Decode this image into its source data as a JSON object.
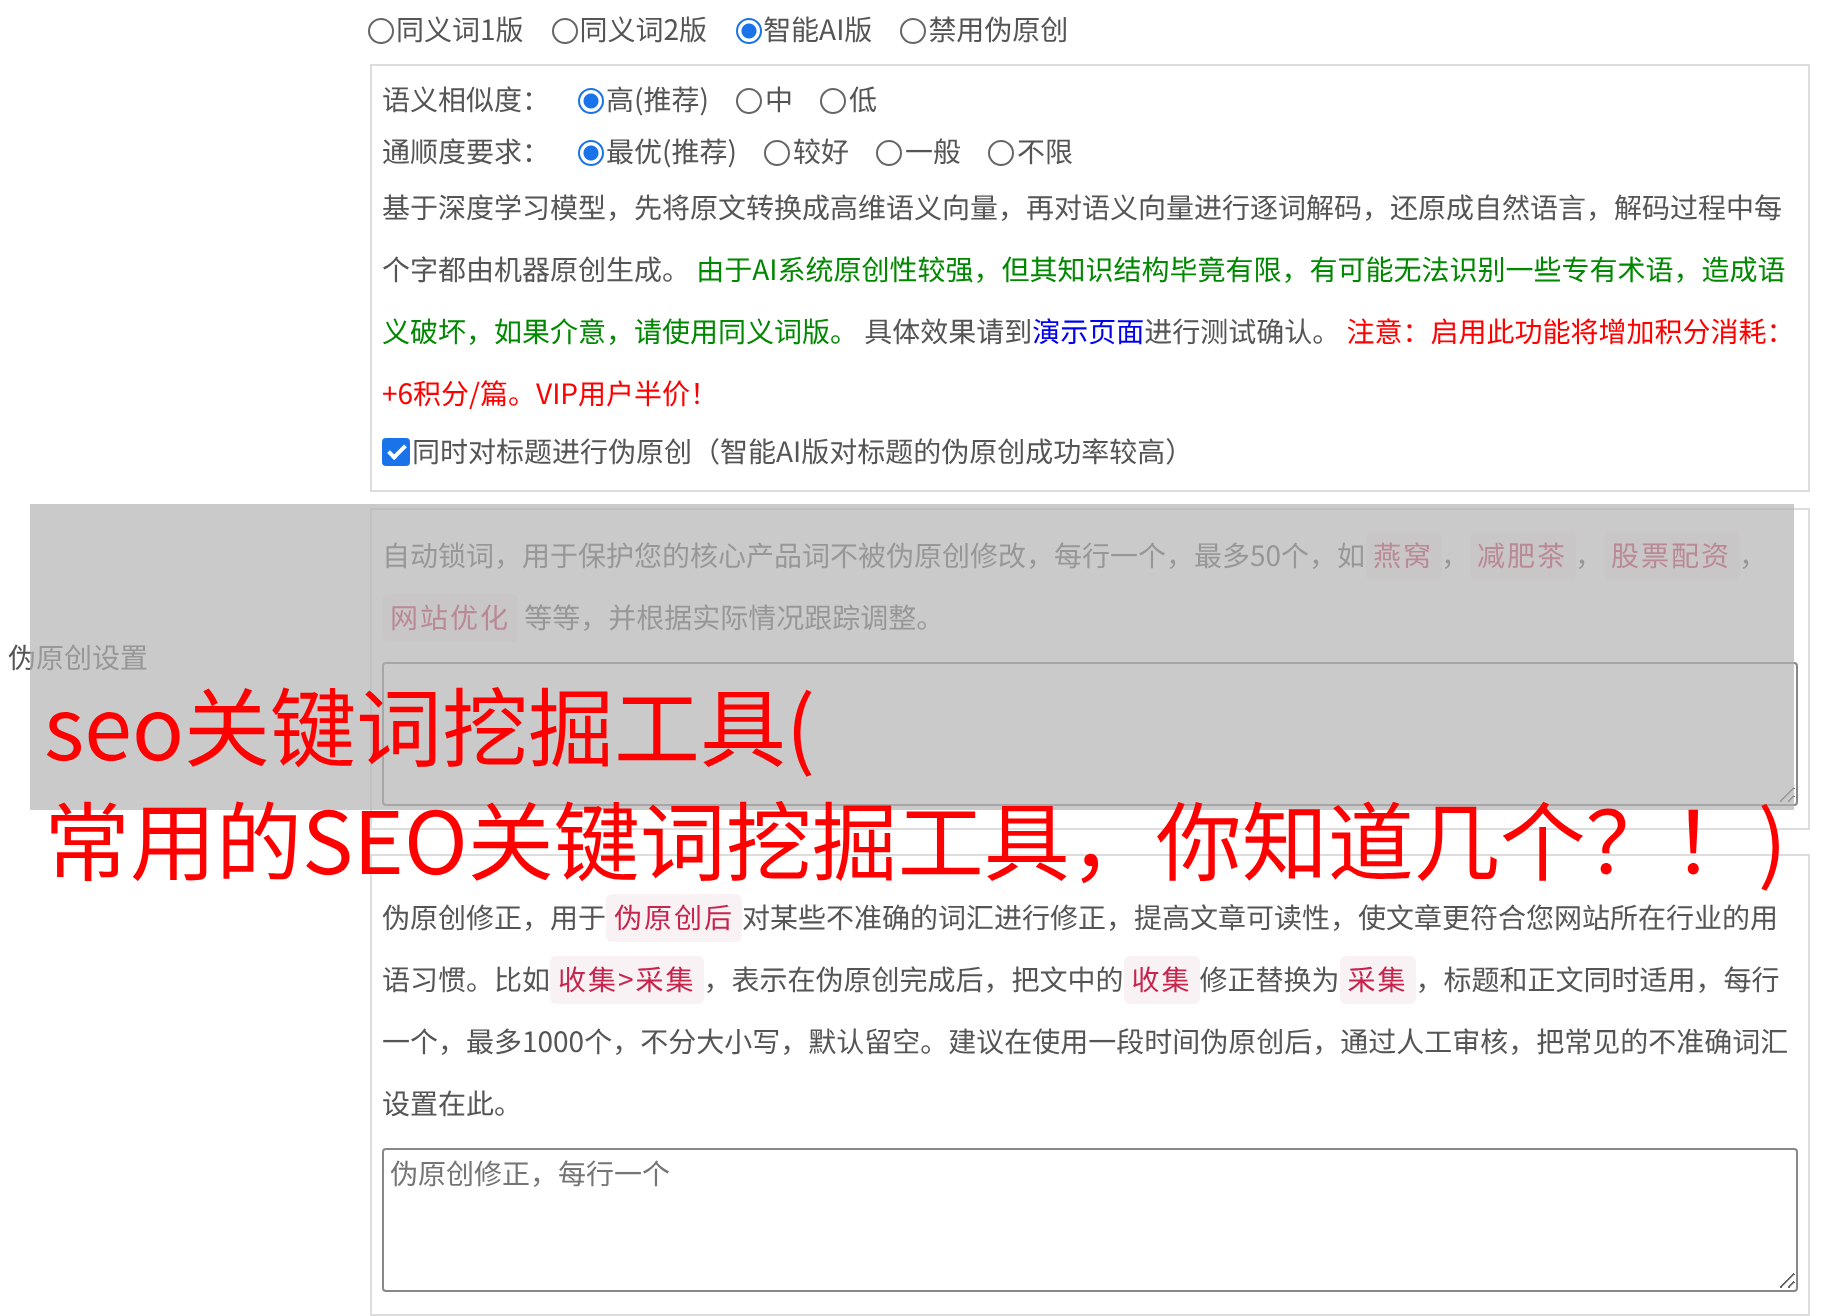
{
  "setting_label": "伪原创设置",
  "modes": [
    {
      "label": "同义词1版",
      "selected": false
    },
    {
      "label": "同义词2版",
      "selected": false
    },
    {
      "label": "智能AI版",
      "selected": true
    },
    {
      "label": "禁用伪原创",
      "selected": false
    }
  ],
  "similarity": {
    "label": "语义相似度：",
    "options": [
      {
        "label": "高(推荐)",
        "selected": true
      },
      {
        "label": "中",
        "selected": false
      },
      {
        "label": "低",
        "selected": false
      }
    ]
  },
  "fluency": {
    "label": "通顺度要求：",
    "options": [
      {
        "label": "最优(推荐)",
        "selected": true
      },
      {
        "label": "较好",
        "selected": false
      },
      {
        "label": "一般",
        "selected": false
      },
      {
        "label": "不限",
        "selected": false
      }
    ]
  },
  "ai_description": [
    {
      "kind": "plain",
      "text": "基于深度学习模型，先将原文转换成高维语义向量，再对语义向量进行逐词解码，还原成自然语言，解码过程中每个字都由机器原创生成。 "
    },
    {
      "kind": "notice",
      "text": "由于AI系统原创性较强，但其知识结构毕竟有限，有可能无法识别一些专有术语，造成语义破坏，如果介意，请使用同义词版。"
    },
    {
      "kind": "plain",
      "text": " 具体效果请到"
    },
    {
      "kind": "link",
      "text": "演示页面"
    },
    {
      "kind": "plain",
      "text": "进行测试确认。 "
    },
    {
      "kind": "warning",
      "text": "注意：启用此功能将增加积分消耗：+6积分/篇。VIP用户半价！"
    }
  ],
  "title_option": {
    "label": "同时对标题进行伪原创（智能AI版对标题的伪原创成功率较高）",
    "checked": true
  },
  "lock_words": {
    "description": [
      {
        "kind": "plain",
        "text": "自动锁词，用于保护您的核心产品词不被伪原创修改，每行一个，最多50个，如"
      },
      {
        "kind": "code",
        "text": "燕窝"
      },
      {
        "kind": "plain",
        "text": "，"
      },
      {
        "kind": "code",
        "text": "减肥茶"
      },
      {
        "kind": "plain",
        "text": "，"
      },
      {
        "kind": "code",
        "text": "股票配资"
      },
      {
        "kind": "plain",
        "text": "，"
      },
      {
        "kind": "code",
        "text": "网站优化"
      },
      {
        "kind": "plain",
        "text": " 等等，并根据实际情况跟踪调整。"
      }
    ]
  },
  "corrections": {
    "description": [
      {
        "kind": "plain",
        "text": "伪原创修正，用于"
      },
      {
        "kind": "code",
        "text": "伪原创后"
      },
      {
        "kind": "plain",
        "text": "对某些不准确的词汇进行修正，提高文章可读性，使文章更符合您网站所在行业的用语习惯。比如"
      },
      {
        "kind": "code",
        "text": "收集>采集"
      },
      {
        "kind": "plain",
        "text": "，表示在伪原创完成后，把文中的"
      },
      {
        "kind": "code",
        "text": "收集"
      },
      {
        "kind": "plain",
        "text": "修正替换为"
      },
      {
        "kind": "code",
        "text": "采集"
      },
      {
        "kind": "plain",
        "text": "，标题和正文同时适用，每行一个，最多1000个，不分大小写，默认留空。建议在使用一段时间伪原创后，通过人工审核，把常见的不准确词汇设置在此。"
      }
    ],
    "placeholder": "伪原创修正，每行一个"
  },
  "overlay": {
    "lines": [
      "seo关键词挖掘工具(",
      "常用的SEO关键词挖掘工具，你知道几个？！)"
    ]
  }
}
